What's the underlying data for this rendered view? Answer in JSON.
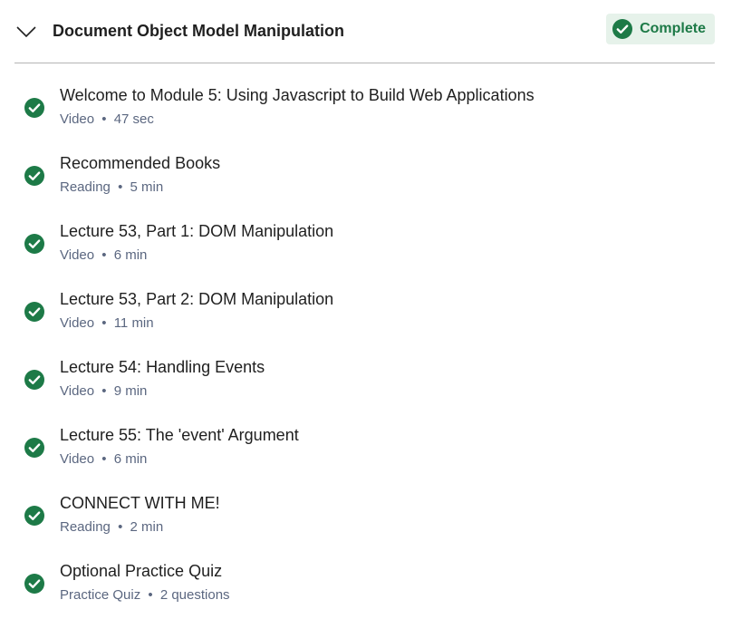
{
  "module": {
    "title": "Document Object Model Manipulation",
    "status": "Complete",
    "status_color": "#1d7a47",
    "toggle_icon": "chevron-down-icon",
    "status_icon": "check-circle-icon"
  },
  "items": [
    {
      "title": "Welcome to Module 5: Using Javascript to Build Web Applications",
      "type": "Video",
      "duration": "47 sec"
    },
    {
      "title": "Recommended Books",
      "type": "Reading",
      "duration": "5 min"
    },
    {
      "title": "Lecture 53, Part 1: DOM Manipulation",
      "type": "Video",
      "duration": "6 min"
    },
    {
      "title": "Lecture 53, Part 2: DOM Manipulation",
      "type": "Video",
      "duration": "11 min"
    },
    {
      "title": "Lecture 54: Handling Events",
      "type": "Video",
      "duration": "9 min"
    },
    {
      "title": "Lecture 55: The 'event' Argument",
      "type": "Video",
      "duration": "6 min"
    },
    {
      "title": "CONNECT WITH ME!",
      "type": "Reading",
      "duration": "2 min"
    },
    {
      "title": "Optional Practice Quiz",
      "type": "Practice Quiz",
      "duration": "2 questions"
    }
  ],
  "meta_separator": "•",
  "item_icon": "check-circle-icon"
}
